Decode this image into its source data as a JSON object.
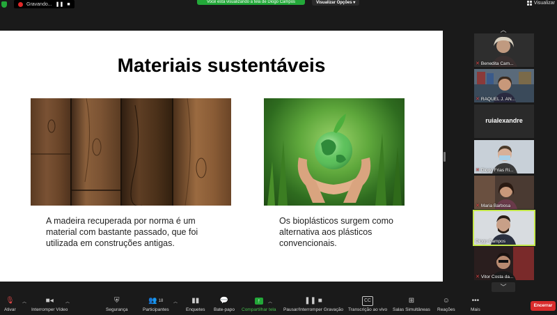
{
  "topbar": {
    "recording_label": "Gravando...",
    "share_banner": "Você está visualizando a tela de Diogo Campos",
    "view_options": "Visualizar Opções",
    "view_button": "Visualizar"
  },
  "slide": {
    "title": "Materiais sustentáveis",
    "left_text": "A madeira recuperada por norma é um material com bastante passado, que foi utilizada em construções antigas.",
    "right_text": "Os bioplásticos surgem como alternativa aos plásticos convencionais."
  },
  "gallery": {
    "participants": [
      {
        "name": "Benedita Cam...",
        "muted": true
      },
      {
        "name": "RAQUEL J. AN...",
        "muted": true
      },
      {
        "name": "ruialexandre",
        "muted": false,
        "video": false
      },
      {
        "name": "Diogo Frias Ri...",
        "muted": true
      },
      {
        "name": "Maria Barbosa",
        "muted": true
      },
      {
        "name": "Diogo Campos",
        "muted": false,
        "active": true
      },
      {
        "name": "Vitor Costa da...",
        "muted": true
      }
    ]
  },
  "toolbar": {
    "mute": "Ativar",
    "video": "Interromper Vídeo",
    "security": "Segurança",
    "participants": "Participantes",
    "participants_count": "18",
    "polls": "Enquetes",
    "chat": "Bate-papo",
    "share": "Compartilhar tela",
    "recording": "Pausar/Interromper Gravação",
    "transcription": "Transcrição ao vivo",
    "breakout": "Salas Simultâneas",
    "reactions": "Reações",
    "more": "Mais",
    "end": "Encerrar"
  },
  "colors": {
    "green": "#23a839",
    "active_border": "#c5e84b",
    "end_red": "#d92c2c",
    "mute_red": "#e04848"
  },
  "icons": [
    "shield-icon",
    "record-dot-icon",
    "pause-icon",
    "stop-icon",
    "grid-icon",
    "mic-off-icon",
    "video-icon",
    "security-shield-icon",
    "participants-icon",
    "polls-icon",
    "chat-icon",
    "share-screen-icon",
    "recording-icon",
    "cc-icon",
    "breakout-icon",
    "reaction-icon",
    "more-icon",
    "chevron-down-icon"
  ]
}
